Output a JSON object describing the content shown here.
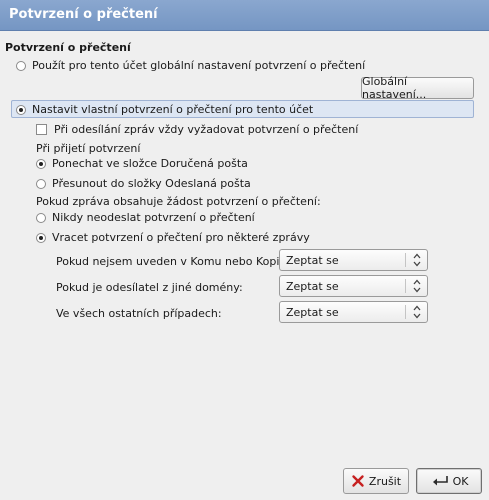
{
  "window": {
    "title": "Potvrzení o přečtení"
  },
  "section": {
    "heading": "Potvrzení o přečtení"
  },
  "options": {
    "use_global": "Použít pro tento účet globální nastavení potvrzení o přečtení",
    "global_button": "Globální nastavení...",
    "custom": "Nastavit vlastní potvrzení o přečtení pro tento účet",
    "always_request": "Při odesílání zpráv vždy vyžadovat potvrzení o přečtení",
    "on_receive_label": "Při přijetí potvrzení",
    "keep_inbox": "Ponechat ve složce Doručená pošta",
    "move_sent": "Přesunout do složky Odeslaná pošta",
    "when_request_label": "Pokud zpráva obsahuje žádost potvrzení o přečtení:",
    "never_send": "Nikdy neodeslat potvrzení o přečtení",
    "allow_some": "Vracet potvrzení o přečtení pro některé zprávy"
  },
  "combos": [
    {
      "label": "Pokud nejsem uveden v Komu nebo Kopie:",
      "value": "Zeptat se"
    },
    {
      "label": "Pokud je odesílatel z jiné domény:",
      "value": "Zeptat se"
    },
    {
      "label": "Ve všech ostatních případech:",
      "value": "Zeptat se"
    }
  ],
  "buttons": {
    "cancel": "Zrušit",
    "ok": "OK"
  },
  "state": {
    "selected_mode": "custom",
    "always_request": false,
    "on_receive": "keep_inbox",
    "when_request": "allow_some"
  },
  "colors": {
    "title_bar": "#7b9ac6",
    "selection": "#dde6f3"
  },
  "icons": {
    "cancel": "cancel-x-icon",
    "ok": "ok-arrow-icon",
    "combo": "updown-arrows-icon"
  }
}
